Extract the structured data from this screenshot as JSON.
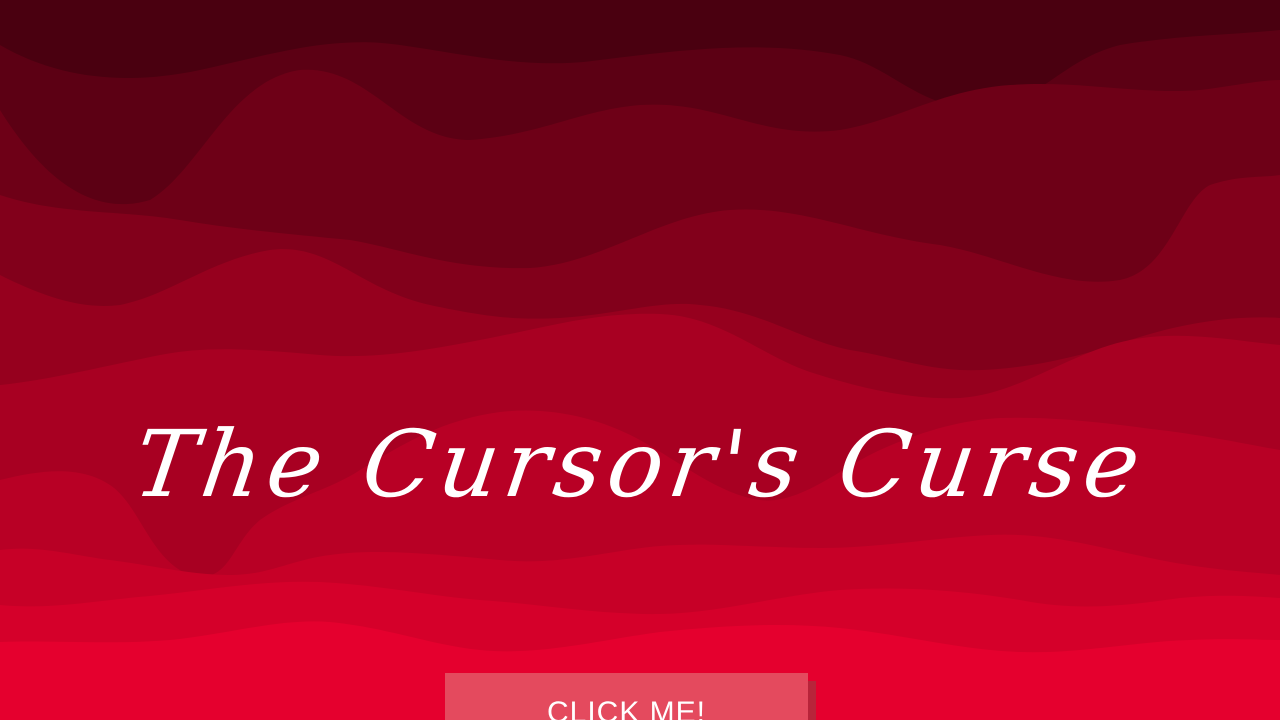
{
  "game": {
    "title": "The Cursor's Curse"
  },
  "button": {
    "label": "CLICK ME!"
  },
  "colors": {
    "text": "#ffffff",
    "button": "#e44a5e",
    "button_shadow": "#b8243a",
    "wave_bands": [
      "#4a0010",
      "#5c0014",
      "#6e0017",
      "#82001b",
      "#96001e",
      "#a80022",
      "#b80025",
      "#c70027",
      "#d5002a",
      "#e5002e"
    ]
  }
}
